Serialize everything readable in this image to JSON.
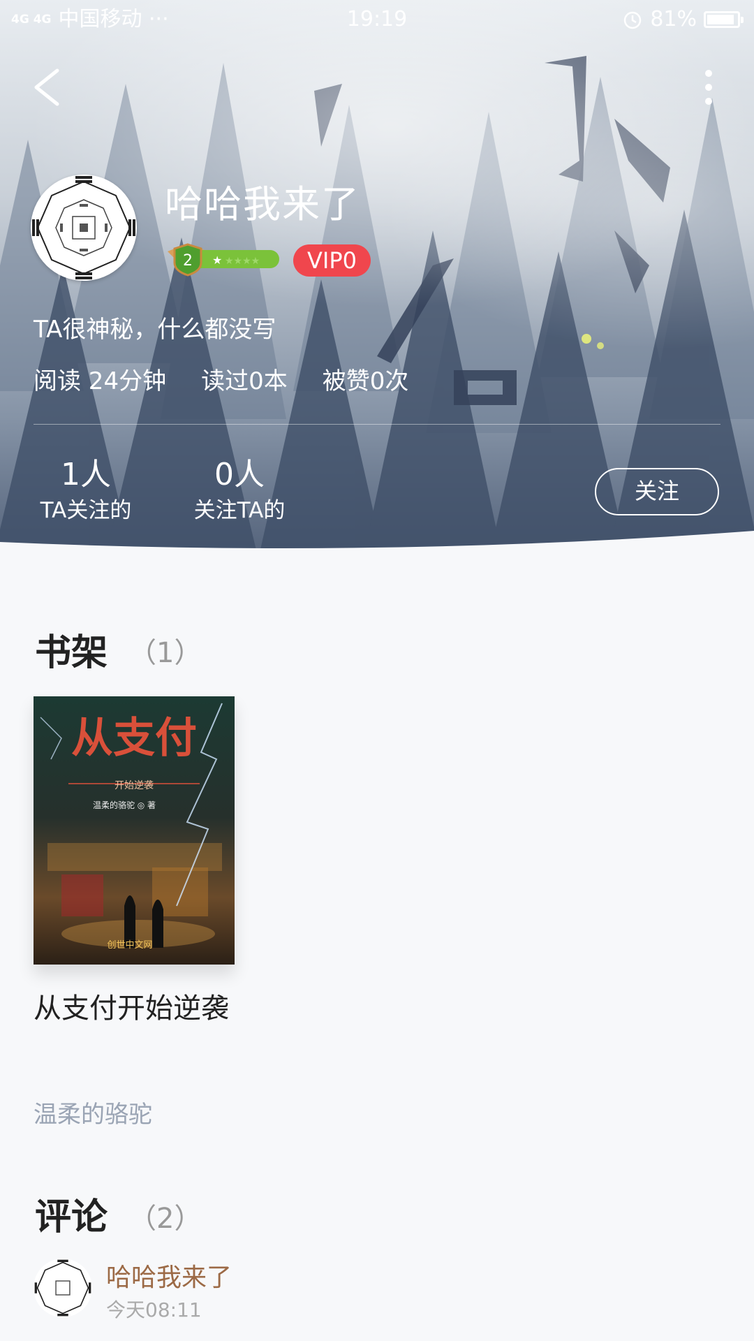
{
  "status_bar": {
    "signal": "4G 4G",
    "carrier": "中国移动 ···",
    "time": "19:19",
    "battery": "81%"
  },
  "profile": {
    "username": "哈哈我来了",
    "level": "2",
    "vip": "VIP0",
    "bio": "TA很神秘，什么都没写",
    "stats": {
      "read_time": "阅读 24分钟",
      "books_read": "读过0本",
      "likes": "被赞0次"
    },
    "following": {
      "count": "1人",
      "label": "TA关注的"
    },
    "followers": {
      "count": "0人",
      "label": "关注TA的"
    },
    "follow_button": "关注"
  },
  "bookshelf": {
    "title": "书架",
    "count": "（1）",
    "books": [
      {
        "cover_title": "从支付",
        "cover_subtitle": "开始逆袭",
        "cover_author": "温柔的骆驼 ◎ 著",
        "cover_publisher": "创世中文网",
        "title": "从支付开始逆袭",
        "author": "温柔的骆驼"
      }
    ]
  },
  "comments": {
    "title": "评论",
    "count": "（2）",
    "items": [
      {
        "user": "哈哈我来了",
        "time": "今天08:11"
      }
    ]
  },
  "colors": {
    "vip_red": "#f0464d",
    "level_green": "#7bc23a",
    "comment_user_brown": "#9c6a46",
    "author_gray": "#9aa4b4"
  }
}
